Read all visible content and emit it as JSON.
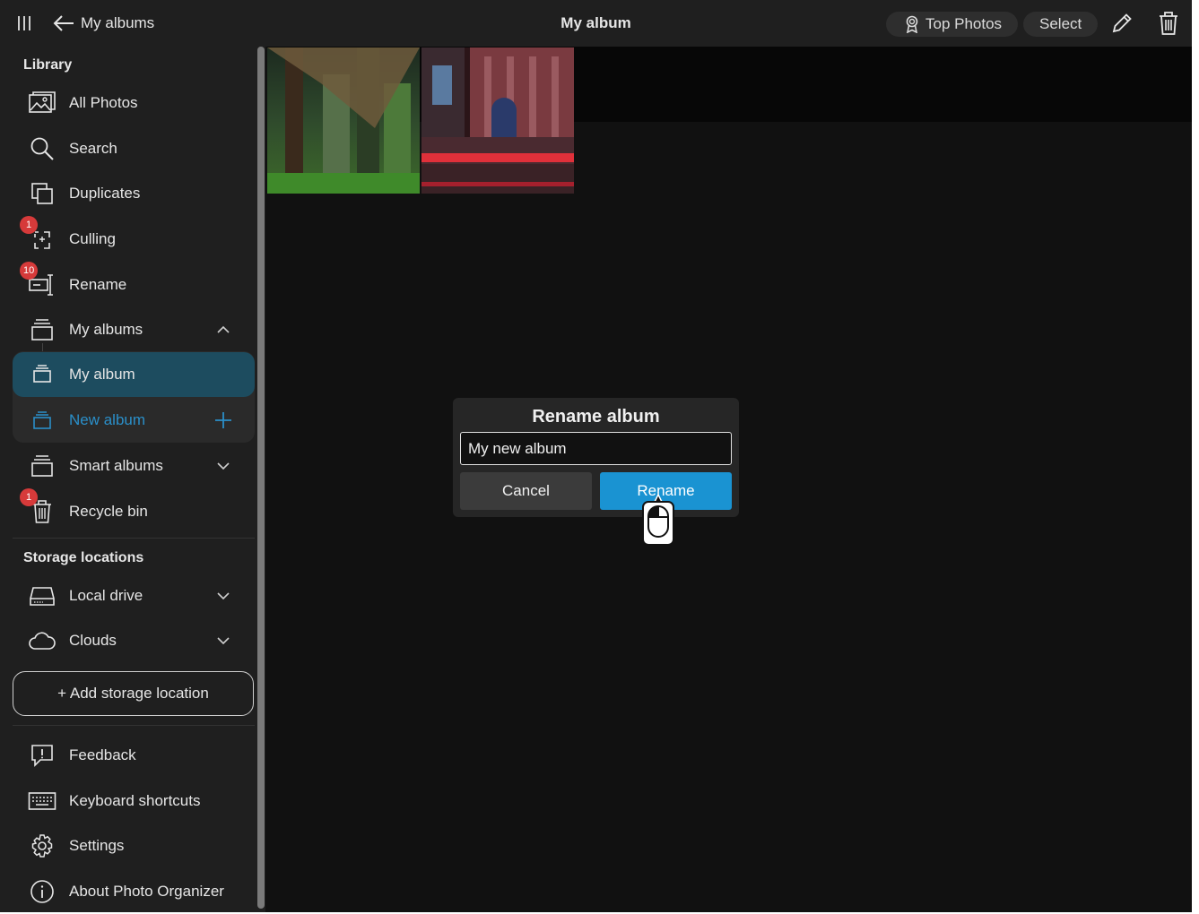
{
  "header": {
    "back_label": "My albums",
    "title": "My album",
    "top_photos_label": "Top Photos",
    "select_label": "Select"
  },
  "sidebar": {
    "library_title": "Library",
    "items": [
      {
        "label": "All Photos",
        "icon": "image-icon"
      },
      {
        "label": "Search",
        "icon": "search-icon"
      },
      {
        "label": "Duplicates",
        "icon": "duplicates-icon"
      },
      {
        "label": "Culling",
        "icon": "culling-icon",
        "badge": "1"
      },
      {
        "label": "Rename",
        "icon": "rename-icon",
        "badge": "10"
      },
      {
        "label": "My albums",
        "icon": "album-icon",
        "expanded": true
      },
      {
        "label": "My album",
        "icon": "album-icon",
        "selected": true
      },
      {
        "label": "New album",
        "icon": "album-icon"
      },
      {
        "label": "Smart albums",
        "icon": "album-icon",
        "expanded": false
      },
      {
        "label": "Recycle bin",
        "icon": "trash-icon",
        "badge": "1"
      }
    ],
    "storage_title": "Storage locations",
    "storage_items": [
      {
        "label": "Local drive",
        "icon": "drive-icon"
      },
      {
        "label": "Clouds",
        "icon": "cloud-icon"
      }
    ],
    "add_storage_label": "+ Add storage location",
    "footer_items": [
      {
        "label": "Feedback",
        "icon": "feedback-icon"
      },
      {
        "label": "Keyboard shortcuts",
        "icon": "keyboard-icon"
      },
      {
        "label": "Settings",
        "icon": "gear-icon"
      },
      {
        "label": "About Photo Organizer",
        "icon": "info-icon"
      }
    ]
  },
  "dialog": {
    "title": "Rename album",
    "input_value": "My new album",
    "cancel_label": "Cancel",
    "rename_label": "Rename"
  },
  "colors": {
    "accent": "#1a93d2",
    "selected_bg": "#1d4c5f",
    "badge": "#d63a3a",
    "new_album_text": "#2a8fc9"
  }
}
